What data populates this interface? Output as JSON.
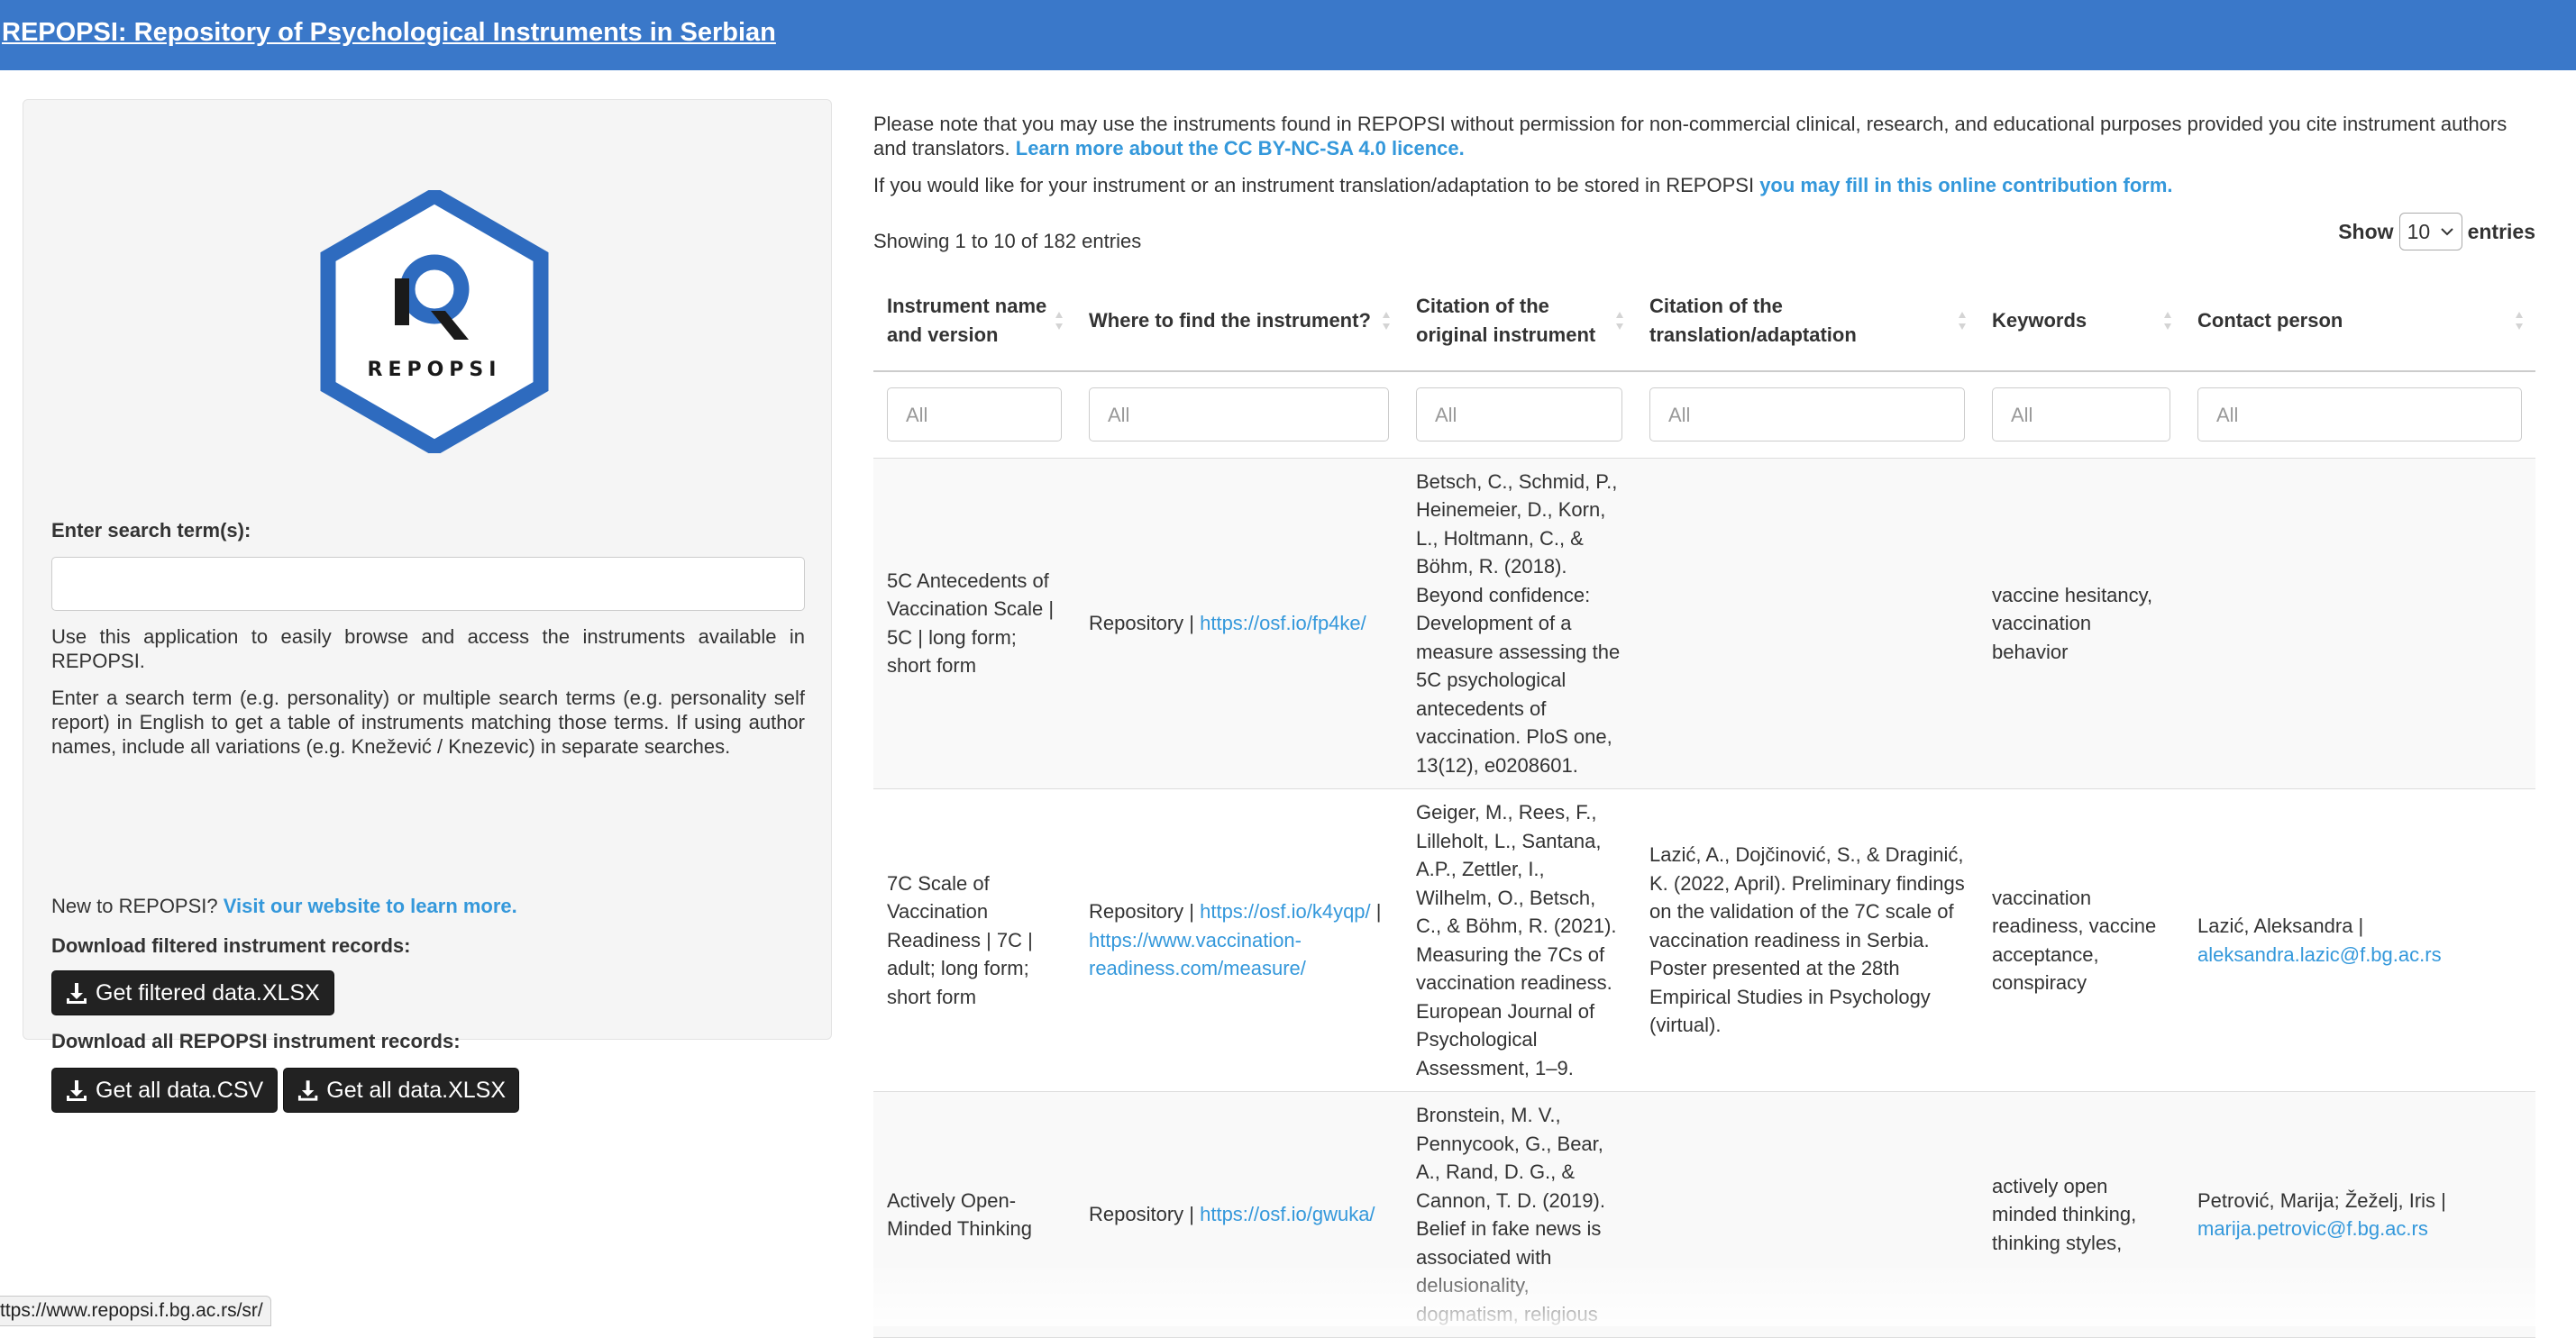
{
  "app": {
    "title": "REPOPSI: Repository of Psychological Instruments in Serbian"
  },
  "colors": {
    "header": "#3a78c9",
    "link": "#3498db",
    "logo_blue": "#2e6bbf",
    "button": "#222222"
  },
  "sidebar": {
    "logo_text": "REPOPSI",
    "search_label": "Enter search term(s):",
    "search_value": "",
    "help_1": "Use this application to easily browse and access the instruments available in REPOPSI.",
    "help_2": "Enter a search term (e.g. personality) or multiple search terms (e.g. personality self report) in English to get a table of instruments matching those terms. If using author names, include all variations (e.g. Knežević / Knezevic) in separate searches.",
    "new_prefix": "New to REPOPSI?",
    "new_link": "Visit our website to learn more.",
    "download_filtered_label": "Download filtered instrument records:",
    "btn_filtered_xlsx": "Get filtered data.XLSX",
    "download_all_label": "Download all REPOPSI instrument records:",
    "btn_all_csv": "Get all data.CSV",
    "btn_all_xlsx": "Get all data.XLSX",
    "download_icon": "download-icon"
  },
  "main": {
    "notice_1_text": "Please note that you may use the instruments found in REPOPSI without permission for non-commercial clinical, research, and educational purposes provided you cite instrument authors and translators.",
    "notice_1_link": "Learn more about the CC BY-NC-SA 4.0 licence.",
    "notice_2_text": "If you would like for your instrument or an instrument translation/adaptation to be stored in REPOPSI",
    "notice_2_link": "you may fill in this online contribution form.",
    "showing": "Showing 1 to 10 of 182 entries",
    "length_show": "Show",
    "length_value": "10",
    "length_entries": "entries"
  },
  "table": {
    "columns": [
      "Instrument name and version",
      "Where to find the instrument?",
      "Citation of the original instrument",
      "Citation of the translation/adaptation",
      "Keywords",
      "Contact person"
    ],
    "filter_placeholder": "All",
    "rows": [
      {
        "name": "5C Antecedents of Vaccination Scale | 5C | long form; short form",
        "where_prefix": "Repository |",
        "where_link_1": "https://osf.io/fp4ke/",
        "where_sep": "",
        "where_link_2": "",
        "original": "Betsch, C., Schmid, P., Heinemeier, D., Korn, L., Holtmann, C., & Böhm, R. (2018). Beyond confidence: Development of a measure assessing the 5C psychological antecedents of vaccination. PloS one, 13(12), e0208601.",
        "translation": "",
        "keywords": "vaccine hesitancy, vaccination behavior",
        "contact_name": "",
        "contact_email": ""
      },
      {
        "name": "7C Scale of Vaccination Readiness | 7C | adult; long form; short form",
        "where_prefix": "Repository |",
        "where_link_1": "https://osf.io/k4yqp/",
        "where_sep": "|",
        "where_link_2": "https://www.vaccination-readiness.com/measure/",
        "original": "Geiger, M., Rees, F., Lilleholt, L., Santana, A.P., Zettler, I., Wilhelm, O., Betsch, C., & Böhm, R. (2021). Measuring the 7Cs of vaccination readiness. European Journal of Psychological Assessment, 1–9.",
        "translation": "Lazić, A., Dojčinović, S., & Draginić, K. (2022, April). Preliminary findings on the validation of the 7C scale of vaccination readiness in Serbia. Poster presented at the 28th Empirical Studies in Psychology (virtual).",
        "keywords": "vaccination readiness, vaccine acceptance, conspiracy",
        "contact_name": "Lazić, Aleksandra |",
        "contact_email": "aleksandra.lazic@f.bg.ac.rs"
      },
      {
        "name": "Actively Open-Minded Thinking",
        "where_prefix": "Repository |",
        "where_link_1": "https://osf.io/gwuka/",
        "where_sep": "",
        "where_link_2": "",
        "original": "Bronstein, M. V., Pennycook, G., Bear, A., Rand, D. G., & Cannon, T. D. (2019). Belief in fake news is associated with delusionality, dogmatism, religious",
        "translation": "",
        "keywords": "actively open minded thinking, thinking styles,",
        "contact_name": "Petrović, Marija; Žeželj, Iris |",
        "contact_email": "marija.petrovic@f.bg.ac.rs"
      }
    ]
  },
  "status_bar": {
    "url": "ttps://www.repopsi.f.bg.ac.rs/sr/"
  }
}
